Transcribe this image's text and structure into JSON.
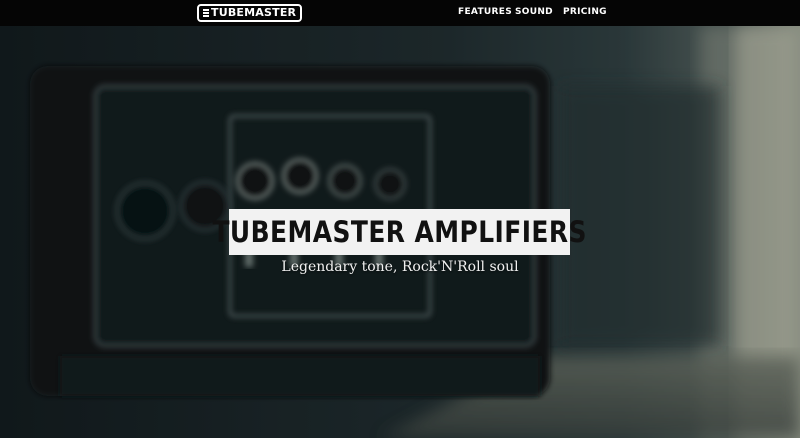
{
  "nav": {
    "logo_text": "TUBEMASTER",
    "links": [
      "FEATURES",
      "SOUND",
      "PRICING"
    ]
  },
  "hero": {
    "title": "TUBEMASTER AMPLIFIERS",
    "subtitle": "Legendary tone, Rock'N'Roll soul",
    "background_image": "amplifier-photo"
  },
  "colors": {
    "navbar": "#050505",
    "title_box": "#f2f2f2",
    "title_text": "#111111",
    "hero_tint": "#1f2e31"
  }
}
